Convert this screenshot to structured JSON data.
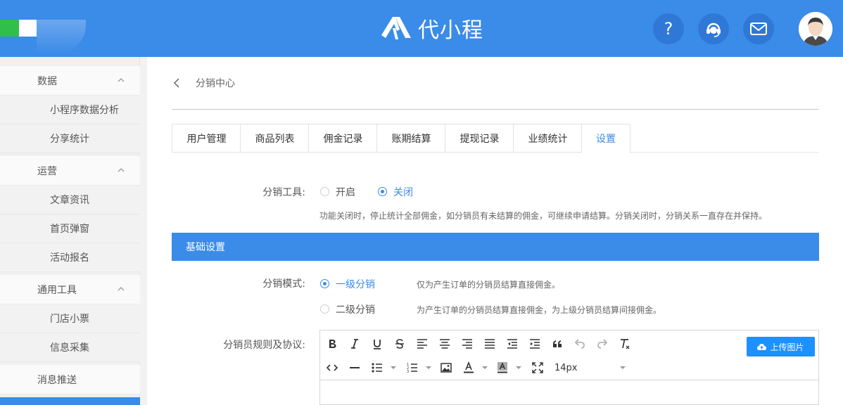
{
  "header": {
    "brand_text": "代小程",
    "icons": [
      "help-icon",
      "customer-service-icon",
      "mail-icon",
      "user-avatar-icon"
    ],
    "colors": {
      "primary": "#3b8be8",
      "button": "#2f78d6"
    }
  },
  "sidebar": {
    "groups": [
      {
        "label": "数据",
        "items": [
          "小程序数据分析",
          "分享统计"
        ]
      },
      {
        "label": "运营",
        "items": [
          "文章资讯",
          "首页弹窗",
          "活动报名"
        ]
      },
      {
        "label": "通用工具",
        "items": [
          "门店小票",
          "信息采集"
        ]
      }
    ],
    "single": "消息推送"
  },
  "breadcrumb": {
    "title": "分销中心"
  },
  "tabs": [
    "用户管理",
    "商品列表",
    "佣金记录",
    "账期结算",
    "提现记录",
    "业绩统计",
    "设置"
  ],
  "active_tab": "设置",
  "tool": {
    "label": "分销工具:",
    "options": [
      "开启",
      "关闭"
    ],
    "selected": "关闭",
    "hint": "功能关闭时，停止统计全部佣金，如分销员有未结算的佣金，可继续申请结算。分销关闭时，分销关系一直存在并保持。"
  },
  "section": {
    "title": "基础设置"
  },
  "mode": {
    "label": "分销模式:",
    "options": [
      {
        "name": "一级分销",
        "desc": "仅为产生订单的分销员结算直接佣金。",
        "selected": true
      },
      {
        "name": "二级分销",
        "desc": "为产生订单的分销员结算直接佣金，为上级分销员结算间接佣金。",
        "selected": false
      }
    ]
  },
  "rules": {
    "label": "分销员规则及协议:",
    "font_size": "14px",
    "upload_label": "上传图片"
  }
}
